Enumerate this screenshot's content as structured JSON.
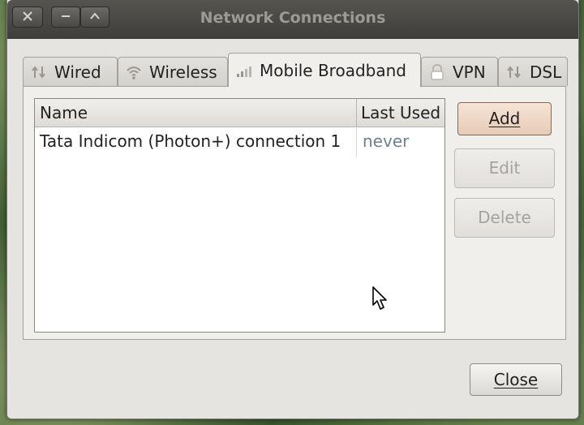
{
  "window": {
    "title": "Network Connections"
  },
  "tabs": [
    {
      "label": "Wired",
      "icon": "wired-icon",
      "active": false
    },
    {
      "label": "Wireless",
      "icon": "wireless-icon",
      "active": false
    },
    {
      "label": "Mobile Broadband",
      "icon": "mobile-broadband-icon",
      "active": true
    },
    {
      "label": "VPN",
      "icon": "vpn-lock-icon",
      "active": false
    },
    {
      "label": "DSL",
      "icon": "dsl-icon",
      "active": false
    }
  ],
  "list": {
    "columns": [
      "Name",
      "Last Used"
    ],
    "rows": [
      {
        "name": "Tata Indicom (Photon+) connection 1",
        "last_used": "never"
      }
    ]
  },
  "buttons": {
    "add_label": "Add",
    "edit_label": "Edit",
    "delete_label": "Delete",
    "close_label": "Close"
  },
  "colors": {
    "titlebar": "#45443f",
    "dialog_bg": "#e6e4e1",
    "last_used_text": "#6f7f92"
  }
}
